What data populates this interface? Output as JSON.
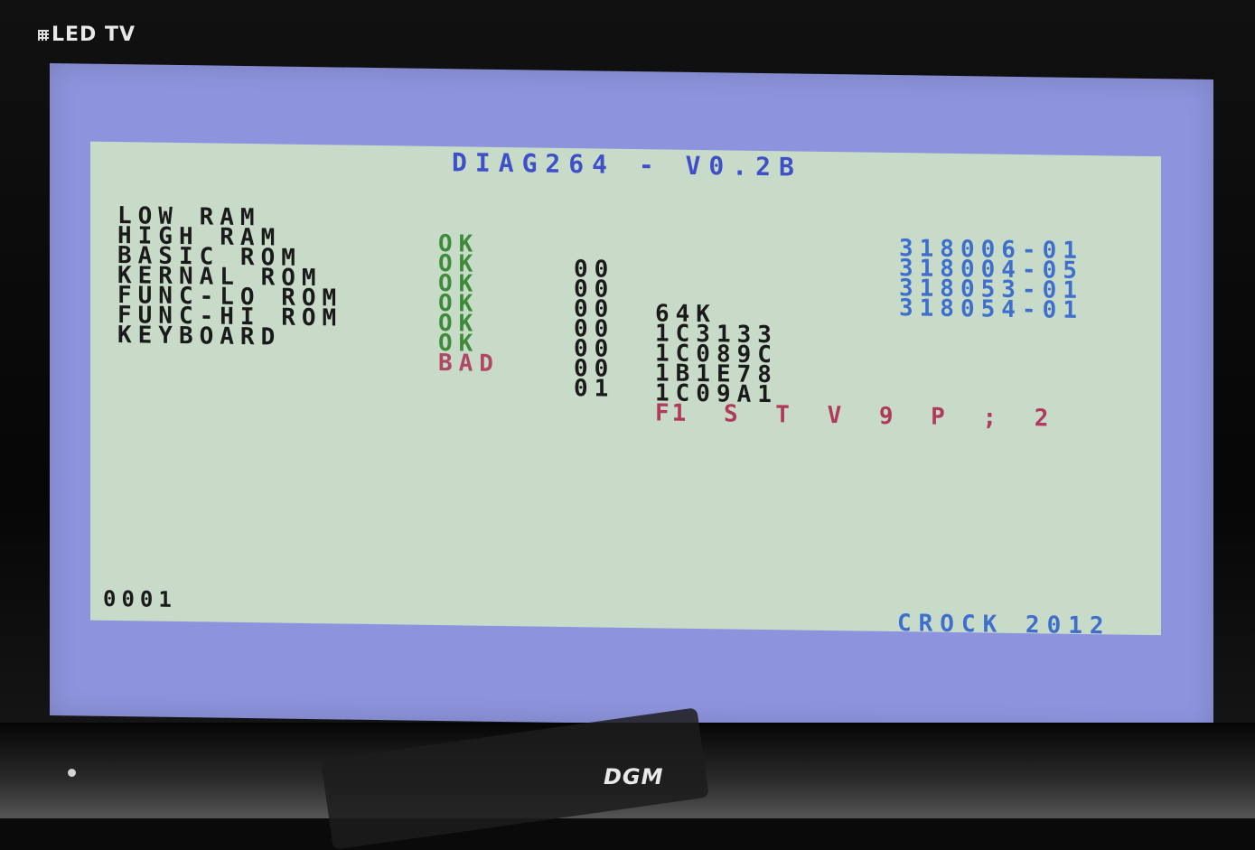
{
  "tv": {
    "brand": "LED TV",
    "maker": "DGM"
  },
  "diag": {
    "title": "DIAG264 - V0.2B",
    "rows": [
      {
        "label": "LOW RAM",
        "status": "OK",
        "code": "00",
        "value": "",
        "part": ""
      },
      {
        "label": "HIGH RAM",
        "status": "OK",
        "code": "00",
        "value": "64K",
        "part": ""
      },
      {
        "label": "BASIC ROM",
        "status": "OK",
        "code": "00",
        "value": "1C3133",
        "part": "318006-01"
      },
      {
        "label": "KERNAL ROM",
        "status": "OK",
        "code": "00",
        "value": "1C089C",
        "part": "318004-05"
      },
      {
        "label": "FUNC-LO ROM",
        "status": "OK",
        "code": "00",
        "value": "1B1E78",
        "part": "318053-01"
      },
      {
        "label": "FUNC-HI ROM",
        "status": "OK",
        "code": "00",
        "value": "1C09A1",
        "part": "318054-01"
      },
      {
        "label": "KEYBOARD",
        "status": "BAD",
        "code": "01",
        "value": "",
        "part": ""
      }
    ],
    "bad_keys": "F1 S T V 9 P ; 2",
    "counter": "0001",
    "credit": "CROCK 2012"
  },
  "colors": {
    "border": "#8d94dd",
    "background": "#c8dbc9",
    "ok": "#3e8c39",
    "bad": "#b04865",
    "title": "#3f4fc8",
    "part": "#3e6fcc"
  }
}
